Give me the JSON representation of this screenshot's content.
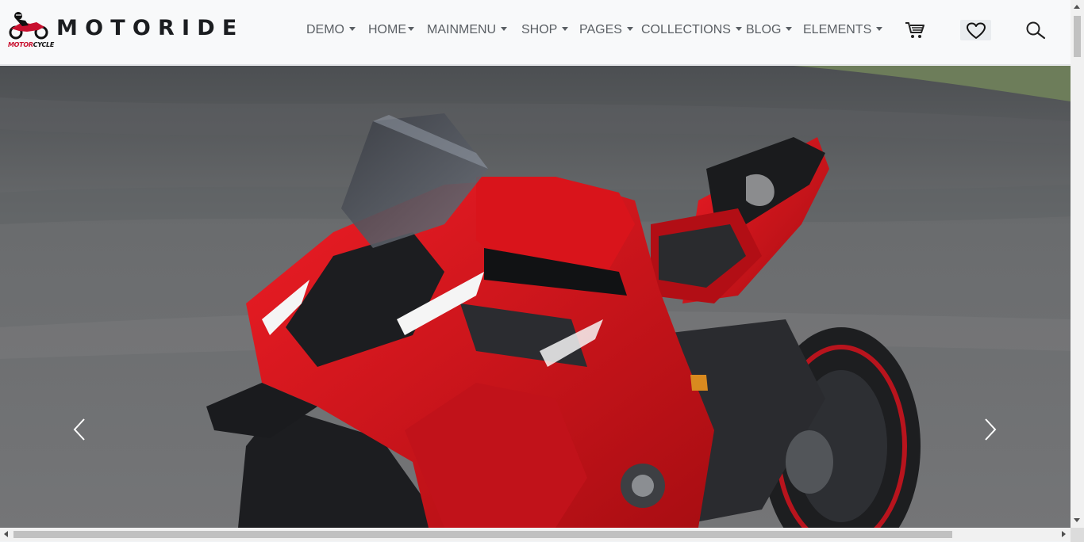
{
  "header": {
    "logo_text_red": "MOTOR",
    "logo_text_dark": "CYCLE",
    "brand": "MOTORIDE"
  },
  "nav": {
    "items": [
      {
        "label": "DEMO"
      },
      {
        "label": "HOME"
      },
      {
        "label": "MAINMENU"
      },
      {
        "label": "SHOP"
      },
      {
        "label": "PAGES"
      },
      {
        "label": "COLLECTIONS"
      },
      {
        "label": "BLOG"
      },
      {
        "label": "ELEMENTS"
      }
    ]
  },
  "icons": {
    "cart": "cart-icon",
    "wishlist": "heart-icon",
    "search": "search-icon",
    "prev": "chevron-left-icon",
    "next": "chevron-right-icon"
  },
  "colors": {
    "navbar_bg": "#f8f9fa",
    "nav_text": "#5a5f64",
    "brand_text": "#1b1d20",
    "accent_red": "#c8102e"
  }
}
